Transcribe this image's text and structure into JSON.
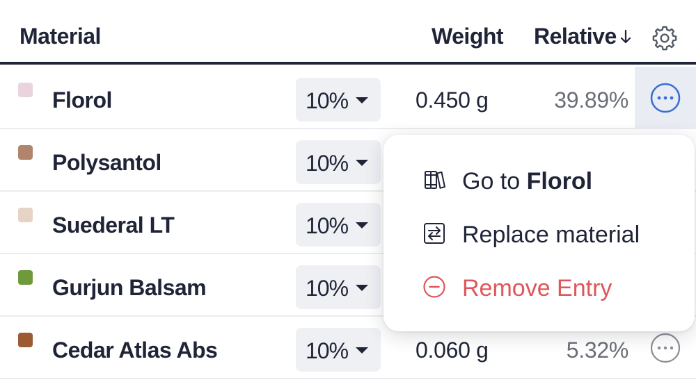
{
  "header": {
    "material": "Material",
    "weight": "Weight",
    "relative": "Relative",
    "sort_icon": "arrow-down-icon",
    "settings_icon": "gear-icon"
  },
  "rows": [
    {
      "name": "Florol",
      "swatch": "#ead3dc",
      "percent": "10%",
      "weight": "0.450 g",
      "relative": "39.89%",
      "active": true
    },
    {
      "name": "Polysantol",
      "swatch": "#b0856b",
      "percent": "10%",
      "weight": "",
      "relative": "",
      "active": false
    },
    {
      "name": "Suederal LT",
      "swatch": "#e7d2c6",
      "percent": "10%",
      "weight": "",
      "relative": "",
      "active": false
    },
    {
      "name": "Gurjun Balsam",
      "swatch": "#6e9a3c",
      "percent": "10%",
      "weight": "",
      "relative": "",
      "active": false
    },
    {
      "name": "Cedar Atlas Abs",
      "swatch": "#9c5a32",
      "percent": "10%",
      "weight": "0.060 g",
      "relative": "5.32%",
      "active": false
    }
  ],
  "menu": {
    "goto_prefix": "Go to ",
    "goto_target": "Florol",
    "replace": "Replace material",
    "remove": "Remove Entry",
    "icons": [
      "books-icon",
      "swap-icon",
      "minus-circle-icon"
    ],
    "danger_color": "#e0555a"
  },
  "colors": {
    "accent": "#3b6fd4",
    "text": "#1f2437",
    "muted": "#6b6e78"
  }
}
